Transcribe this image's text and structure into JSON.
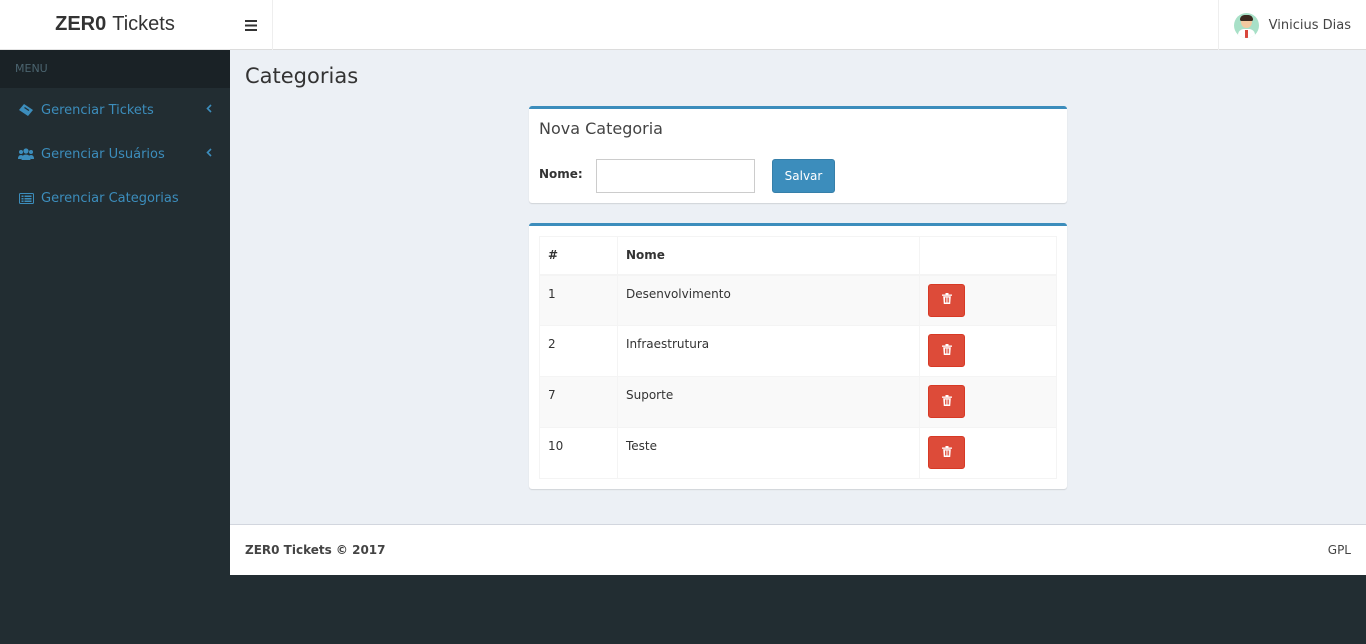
{
  "brand": {
    "bold": "ZER0",
    "light": "Tickets"
  },
  "header": {
    "user_name": "Vinicius Dias"
  },
  "sidebar": {
    "header": "MENU",
    "items": [
      {
        "label": "Gerenciar Tickets",
        "icon": "ticket-icon",
        "has_submenu": true
      },
      {
        "label": "Gerenciar Usuários",
        "icon": "users-icon",
        "has_submenu": true
      },
      {
        "label": "Gerenciar Categorias",
        "icon": "list-icon",
        "has_submenu": false
      }
    ]
  },
  "page": {
    "title": "Categorias"
  },
  "form": {
    "title": "Nova Categoria",
    "name_label": "Nome:",
    "name_value": "",
    "save_label": "Salvar"
  },
  "table": {
    "headers": [
      "#",
      "Nome",
      ""
    ],
    "rows": [
      {
        "id": "1",
        "name": "Desenvolvimento"
      },
      {
        "id": "2",
        "name": "Infraestrutura"
      },
      {
        "id": "7",
        "name": "Suporte"
      },
      {
        "id": "10",
        "name": "Teste"
      }
    ]
  },
  "footer": {
    "copyright": "ZER0 Tickets © 2017",
    "license": "GPL"
  },
  "colors": {
    "primary": "#3c8dbc",
    "danger": "#dd4b39",
    "sidebar_bg": "#222d32",
    "content_bg": "#ecf0f5"
  }
}
